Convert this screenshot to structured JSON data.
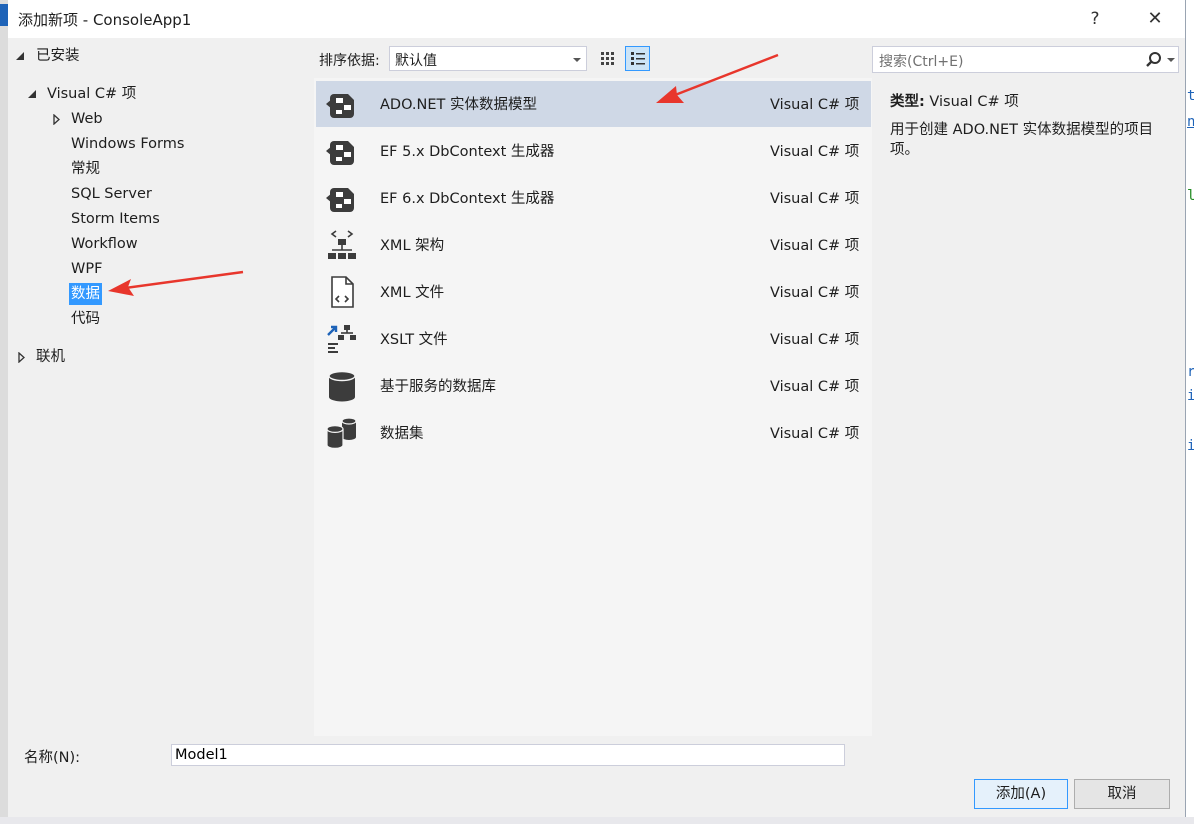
{
  "window": {
    "title": "添加新项 - ConsoleApp1",
    "help_glyph": "?",
    "close_glyph": "✕"
  },
  "tree": {
    "installed": "已安装",
    "visual_csharp": "Visual C# 项",
    "children": [
      "Web",
      "Windows Forms",
      "常规",
      "SQL Server",
      "Storm Items",
      "Workflow",
      "WPF",
      "数据",
      "代码"
    ],
    "selected": "数据",
    "online": "联机"
  },
  "toolbar": {
    "sort_label": "排序依据:",
    "sort_value": "默认值",
    "search_placeholder": "搜索(Ctrl+E)"
  },
  "templates": [
    {
      "name": "ADO.NET 实体数据模型",
      "type": "Visual C# 项",
      "icon": "entity-model-icon",
      "selected": true
    },
    {
      "name": "EF 5.x DbContext 生成器",
      "type": "Visual C# 项",
      "icon": "dbcontext-generator-icon"
    },
    {
      "name": "EF 6.x DbContext 生成器",
      "type": "Visual C# 项",
      "icon": "dbcontext-generator-icon"
    },
    {
      "name": "XML 架构",
      "type": "Visual C# 项",
      "icon": "xml-schema-icon"
    },
    {
      "name": "XML 文件",
      "type": "Visual C# 项",
      "icon": "xml-file-icon"
    },
    {
      "name": "XSLT 文件",
      "type": "Visual C# 项",
      "icon": "xslt-file-icon"
    },
    {
      "name": "基于服务的数据库",
      "type": "Visual C# 项",
      "icon": "database-icon"
    },
    {
      "name": "数据集",
      "type": "Visual C# 项",
      "icon": "dataset-icon"
    }
  ],
  "details": {
    "type_label": "类型:",
    "type_value": "Visual C# 项",
    "description": "用于创建 ADO.NET 实体数据模型的项目项。"
  },
  "form": {
    "name_label": "名称(N):",
    "name_value": "Model1"
  },
  "buttons": {
    "add": "添加(A)",
    "cancel": "取消"
  },
  "background_code_fragments": [
    "t",
    "n",
    "l",
    "r",
    "i",
    "i"
  ],
  "colors": {
    "selection": "#3399ff",
    "selected_row": "#cfd8e6",
    "annotation_arrow": "#e8362c"
  }
}
